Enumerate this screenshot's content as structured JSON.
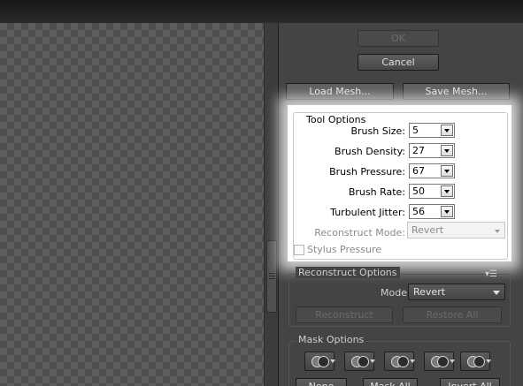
{
  "dialog": {
    "ok_label": "OK",
    "cancel_label": "Cancel",
    "load_mesh_label": "Load Mesh...",
    "save_mesh_label": "Save Mesh..."
  },
  "tool_options": {
    "title": "Tool Options",
    "brush_size": {
      "label": "Brush Size:",
      "value": "5"
    },
    "brush_density": {
      "label": "Brush Density:",
      "value": "27"
    },
    "brush_pressure": {
      "label": "Brush Pressure:",
      "value": "67"
    },
    "brush_rate": {
      "label": "Brush Rate:",
      "value": "50"
    },
    "turbulent_jitter": {
      "label": "Turbulent Jitter:",
      "value": "56"
    },
    "reconstruct_mode": {
      "label": "Reconstruct Mode:",
      "value": "Revert"
    },
    "stylus_pressure_label": "Stylus Pressure"
  },
  "reconstruct_options": {
    "title": "Reconstruct Options",
    "mode_label": "Mode:",
    "mode_value": "Revert",
    "reconstruct_label": "Reconstruct",
    "restore_all_label": "Restore All"
  },
  "mask_options": {
    "title": "Mask Options",
    "none_label": "None",
    "mask_all_label": "Mask All",
    "invert_all_label": "Invert All"
  },
  "icons": {
    "panel_menu": "panel-menu-icon",
    "mask_mode": "mask-mode-icon",
    "dropdown": "chevron-down-icon"
  }
}
